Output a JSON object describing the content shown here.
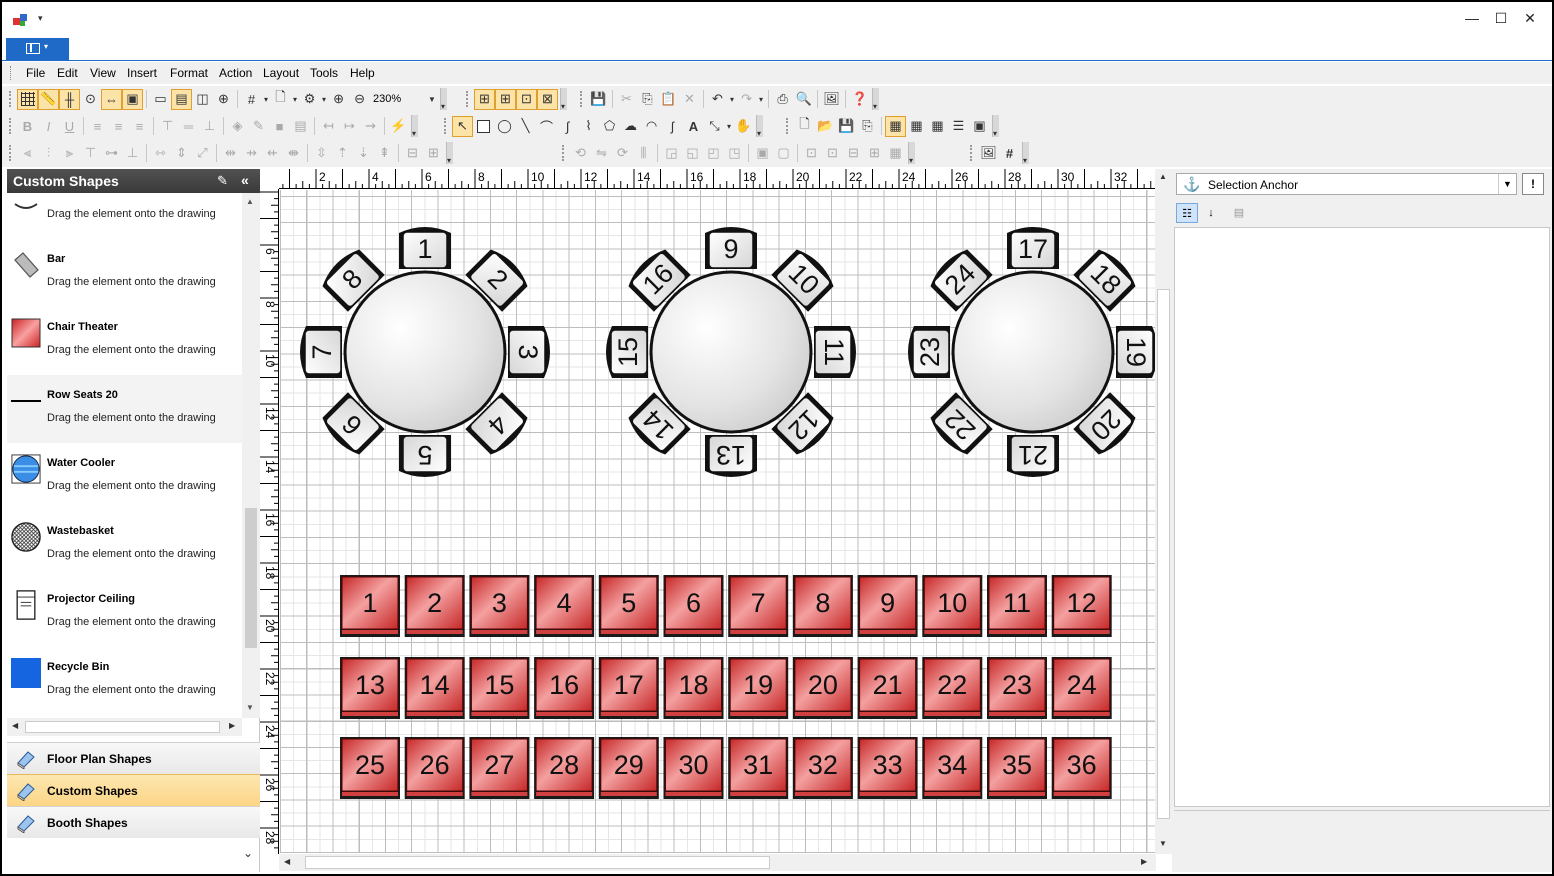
{
  "window": {
    "minimize": "—",
    "maximize": "☐",
    "close": "✕"
  },
  "menu": [
    "File",
    "Edit",
    "View",
    "Insert",
    "Format",
    "Action",
    "Layout",
    "Tools",
    "Help"
  ],
  "toolbar": {
    "zoom": "230%"
  },
  "left_panel": {
    "title": "Custom Shapes",
    "items": [
      {
        "name": "",
        "desc": "Drag the element onto the drawing",
        "icon": "partial-shape-icon"
      },
      {
        "name": "Bar",
        "desc": "Drag the element onto the drawing",
        "icon": "bar-icon"
      },
      {
        "name": "Chair Theater",
        "desc": "Drag the element onto the drawing",
        "icon": "chair-theater-icon"
      },
      {
        "name": "Row Seats 20",
        "desc": "Drag the element onto the drawing",
        "icon": "row-seats-icon"
      },
      {
        "name": "Water Cooler",
        "desc": "Drag the element onto the drawing",
        "icon": "water-cooler-icon"
      },
      {
        "name": "Wastebasket",
        "desc": "Drag the element onto the drawing",
        "icon": "wastebasket-icon"
      },
      {
        "name": "Projector Ceiling",
        "desc": "Drag the element onto the drawing",
        "icon": "projector-icon"
      },
      {
        "name": "Recycle Bin",
        "desc": "Drag the element onto the drawing",
        "icon": "recycle-bin-icon"
      }
    ],
    "categories": [
      {
        "label": "Floor Plan Shapes",
        "selected": false
      },
      {
        "label": "Custom Shapes",
        "selected": true
      },
      {
        "label": "Booth Shapes",
        "selected": false
      }
    ]
  },
  "rulers": {
    "horizontal": [
      "2",
      "4",
      "6",
      "8",
      "10",
      "12",
      "14",
      "16",
      "18",
      "20",
      "22",
      "24",
      "26",
      "28",
      "30",
      "32"
    ],
    "vertical": [
      "6",
      "8",
      "10",
      "12",
      "14",
      "16",
      "18",
      "20",
      "22",
      "24",
      "26",
      "28"
    ]
  },
  "drawing": {
    "round_tables": [
      {
        "seats": [
          "1",
          "2",
          "3",
          "4",
          "5",
          "6",
          "7",
          "8"
        ]
      },
      {
        "seats": [
          "9",
          "10",
          "11",
          "12",
          "13",
          "14",
          "15",
          "16"
        ]
      },
      {
        "seats": [
          "17",
          "18",
          "19",
          "20",
          "21",
          "22",
          "23",
          "24"
        ]
      }
    ],
    "theater_rows": [
      [
        "1",
        "2",
        "3",
        "4",
        "5",
        "6",
        "7",
        "8",
        "9",
        "10",
        "11",
        "12"
      ],
      [
        "13",
        "14",
        "15",
        "16",
        "17",
        "18",
        "19",
        "20",
        "21",
        "22",
        "23",
        "24"
      ],
      [
        "25",
        "26",
        "27",
        "28",
        "29",
        "30",
        "31",
        "32",
        "33",
        "34",
        "35",
        "36"
      ]
    ]
  },
  "properties": {
    "selected_object": "Selection Anchor"
  },
  "colors": {
    "accent": "#1f6ac7",
    "chair_red": "#e04848",
    "selected_nav": "#fcd586"
  }
}
